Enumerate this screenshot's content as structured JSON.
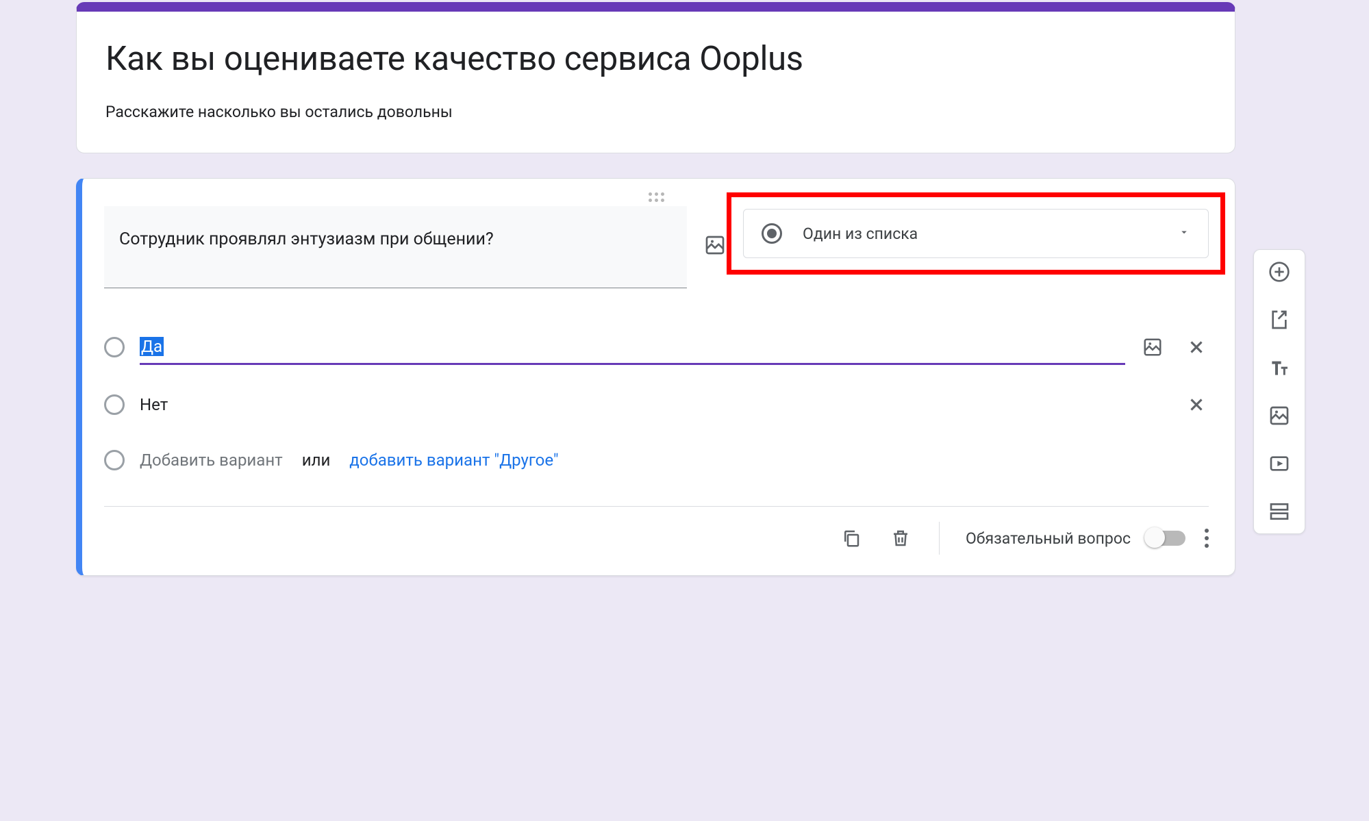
{
  "header": {
    "title": "Как вы оцениваете качество сервиса Ooplus",
    "description": "Расскажите насколько вы остались довольны"
  },
  "question": {
    "text": "Сотрудник проявлял энтузиазм при общении?",
    "type_label": "Один из списка"
  },
  "options": [
    {
      "label": "Да",
      "selected": true,
      "has_image_btn": true,
      "removable": true
    },
    {
      "label": "Нет",
      "selected": false,
      "has_image_btn": false,
      "removable": true
    }
  ],
  "add_option": {
    "placeholder": "Добавить вариант",
    "or": "или",
    "other_link": "добавить вариант \"Другое\""
  },
  "footer": {
    "required_label": "Обязательный вопрос"
  },
  "side_toolbar": {
    "add_question": "add-question",
    "import": "import-questions",
    "title_desc": "add-title",
    "add_image": "add-image",
    "add_video": "add-video",
    "add_section": "add-section"
  },
  "colors": {
    "accent": "#673ab7",
    "active": "#4285f4",
    "highlight": "#ff0000"
  }
}
